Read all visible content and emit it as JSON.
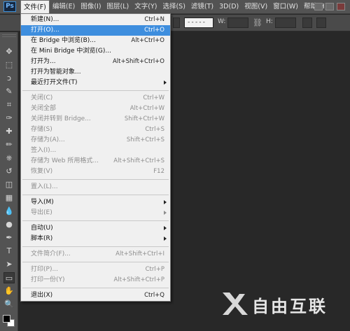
{
  "app": {
    "logo": "Ps"
  },
  "menubar": {
    "items": [
      "文件(F)",
      "编辑(E)",
      "图像(I)",
      "图层(L)",
      "文字(Y)",
      "选择(S)",
      "滤镜(T)",
      "3D(D)",
      "视图(V)",
      "窗口(W)",
      "帮助(H)"
    ],
    "active_index": 0
  },
  "options_bar": {
    "stroke_style": "-----",
    "width_label": "W:",
    "height_label": "H:",
    "link_icon": "chain-link-icon"
  },
  "file_menu": {
    "items": [
      {
        "label": "新建(N)...",
        "shortcut": "Ctrl+N",
        "enabled": true
      },
      {
        "label": "打开(O)...",
        "shortcut": "Ctrl+O",
        "enabled": true,
        "highlight": true
      },
      {
        "label": "在 Bridge 中浏览(B)...",
        "shortcut": "Alt+Ctrl+O",
        "enabled": true
      },
      {
        "label": "在 Mini Bridge 中浏览(G)...",
        "shortcut": "",
        "enabled": true
      },
      {
        "label": "打开为...",
        "shortcut": "Alt+Shift+Ctrl+O",
        "enabled": true
      },
      {
        "label": "打开为智能对象...",
        "shortcut": "",
        "enabled": true
      },
      {
        "label": "最近打开文件(T)",
        "shortcut": "",
        "enabled": true,
        "submenu": true
      },
      {
        "separator": true
      },
      {
        "label": "关闭(C)",
        "shortcut": "Ctrl+W",
        "enabled": false
      },
      {
        "label": "关闭全部",
        "shortcut": "Alt+Ctrl+W",
        "enabled": false
      },
      {
        "label": "关闭并转到 Bridge...",
        "shortcut": "Shift+Ctrl+W",
        "enabled": false
      },
      {
        "label": "存储(S)",
        "shortcut": "Ctrl+S",
        "enabled": false
      },
      {
        "label": "存储为(A)...",
        "shortcut": "Shift+Ctrl+S",
        "enabled": false
      },
      {
        "label": "签入(I)...",
        "shortcut": "",
        "enabled": false
      },
      {
        "label": "存储为 Web 所用格式...",
        "shortcut": "Alt+Shift+Ctrl+S",
        "enabled": false
      },
      {
        "label": "恢复(V)",
        "shortcut": "F12",
        "enabled": false
      },
      {
        "separator": true
      },
      {
        "label": "置入(L)...",
        "shortcut": "",
        "enabled": false
      },
      {
        "separator": true
      },
      {
        "label": "导入(M)",
        "shortcut": "",
        "enabled": true,
        "submenu": true
      },
      {
        "label": "导出(E)",
        "shortcut": "",
        "enabled": false,
        "submenu": true
      },
      {
        "separator": true
      },
      {
        "label": "自动(U)",
        "shortcut": "",
        "enabled": true,
        "submenu": true
      },
      {
        "label": "脚本(R)",
        "shortcut": "",
        "enabled": true,
        "submenu": true
      },
      {
        "separator": true
      },
      {
        "label": "文件简介(F)...",
        "shortcut": "Alt+Shift+Ctrl+I",
        "enabled": false
      },
      {
        "separator": true
      },
      {
        "label": "打印(P)...",
        "shortcut": "Ctrl+P",
        "enabled": false
      },
      {
        "label": "打印一份(Y)",
        "shortcut": "Alt+Shift+Ctrl+P",
        "enabled": false
      },
      {
        "separator": true
      },
      {
        "label": "退出(X)",
        "shortcut": "Ctrl+Q",
        "enabled": true
      }
    ]
  },
  "toolbar": {
    "tools": [
      "move-tool",
      "marquee-tool",
      "lasso-tool",
      "quick-select-tool",
      "crop-tool",
      "eyedropper-tool",
      "healing-brush-tool",
      "brush-tool",
      "clone-stamp-tool",
      "history-brush-tool",
      "eraser-tool",
      "gradient-tool",
      "blur-tool",
      "dodge-tool",
      "pen-tool",
      "type-tool",
      "path-select-tool",
      "shape-tool",
      "hand-tool",
      "zoom-tool"
    ]
  },
  "watermark": {
    "text": "自由互联"
  }
}
